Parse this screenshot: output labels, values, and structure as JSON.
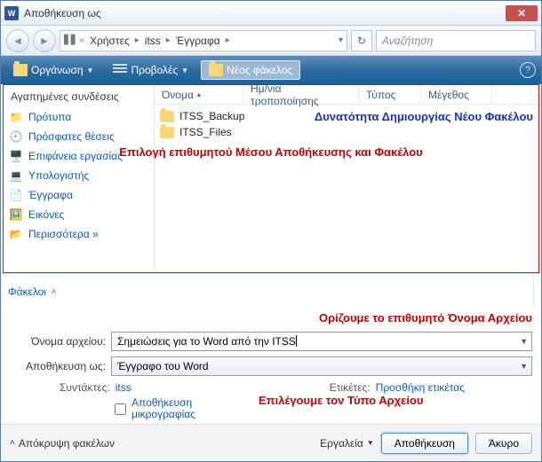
{
  "title": "Αποθήκευση ως",
  "breadcrumb": [
    "Χρήστες",
    "itss",
    "Έγγραφα"
  ],
  "search_placeholder": "Αναζήτηση",
  "toolbar": {
    "organize": "Οργάνωση",
    "views": "Προβολές",
    "new_folder": "Νέος φάκελος"
  },
  "favorites": {
    "heading": "Αγαπημένες συνδέσεις",
    "items": [
      {
        "icon": "📁",
        "label": "Πρότυπα"
      },
      {
        "icon": "🕘",
        "label": "Πρόσφατες θέσεις"
      },
      {
        "icon": "🖥️",
        "label": "Επιφάνεια εργασίας"
      },
      {
        "icon": "💻",
        "label": "Υπολογιστής"
      },
      {
        "icon": "📄",
        "label": "Έγγραφα"
      },
      {
        "icon": "🖼️",
        "label": "Εικόνες"
      },
      {
        "icon": "📂",
        "label": "Περισσότερα »"
      }
    ]
  },
  "columns": [
    "Όνομα",
    "Ημ/νία τροποποίησης",
    "Τύπος",
    "Μέγεθος"
  ],
  "files": [
    {
      "name": "ITSS_Backup"
    },
    {
      "name": "ITSS_Files"
    }
  ],
  "annotations": {
    "new_folder": "Δυνατότητα Δημιουργίας Νέου Φακέλου",
    "choose_loc": "Επιλογή επιθυμητού Μέσου Αποθήκευσης και Φακέλου",
    "filename": "Ορίζουμε το επιθυμητό Όνομα Αρχείου",
    "filetype": "Επιλέγουμε τον Τύπο Αρχείου"
  },
  "folders_label": "Φάκελοι",
  "form": {
    "filename_label": "Όνομα αρχείου:",
    "filename_value": "Σημειώσεις για το Word από την ITSS",
    "saveas_label": "Αποθήκευση ως:",
    "saveas_value": "Έγγραφο του Word",
    "authors_label": "Συντάκτες:",
    "authors_value": "itss",
    "tags_label": "Ετικέτες:",
    "tags_value": "Προσθήκη ετικέτας",
    "thumb_label": "Αποθήκευση μικρογραφίας"
  },
  "footer": {
    "hide_folders": "Απόκρυψη φακέλων",
    "tools": "Εργαλεία",
    "save": "Αποθήκευση",
    "cancel": "Άκυρο"
  }
}
